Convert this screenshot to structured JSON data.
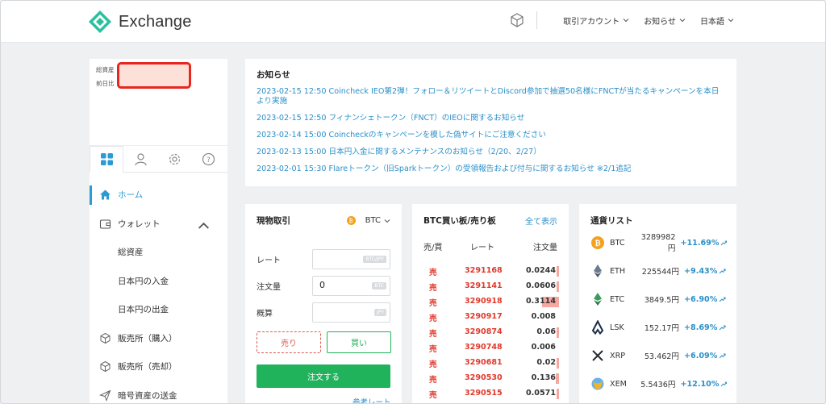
{
  "header": {
    "logo_text": "Exchange",
    "menus": [
      "取引アカウント",
      "お知らせ",
      "日本語"
    ],
    "brand_color": "#2ac09e"
  },
  "sidebar": {
    "assets_label": "総資産",
    "prev_day_label": "前日比",
    "tabs": [
      "dashboard-icon",
      "user-icon",
      "gear-icon",
      "help-icon"
    ],
    "items": [
      {
        "label": "ホーム",
        "icon": "home-icon",
        "active": true
      },
      {
        "label": "ウォレット",
        "icon": "wallet-icon"
      },
      {
        "label": "総資産",
        "sub": true
      },
      {
        "label": "日本円の入金",
        "sub": true
      },
      {
        "label": "日本円の出金",
        "sub": true
      },
      {
        "label": "販売所（購入）",
        "icon": "cube-icon"
      },
      {
        "label": "販売所（売却）",
        "icon": "cube-icon"
      },
      {
        "label": "暗号資産の送金",
        "icon": "send-icon"
      }
    ]
  },
  "notices": {
    "title": "お知らせ",
    "items": [
      "2023-02-15 12:50 Coincheck IEO第2弾！フォロー＆リツイートとDiscord参加で抽選50名様にFNCTが当たるキャンペーンを本日より実施",
      "2023-02-15 12:50 フィナンシェトークン（FNCT）のIEOに関するお知らせ",
      "2023-02-14 15:00 Coincheckのキャンペーンを模した偽サイトにご注意ください",
      "2023-02-13 15:00 日本円入金に関するメンテナンスのお知らせ（2/20、2/27）",
      "2023-02-01 15:30 Flareトークン（旧Sparkトークン）の受領報告および付与に関するお知らせ ※2/1追記"
    ]
  },
  "trade": {
    "title": "現物取引",
    "coin": "BTC",
    "coin_glyph": "₿",
    "rate_label": "レート",
    "rate_tag": "BTC/JPY",
    "qty_label": "注文量",
    "qty_value": "0",
    "qty_tag": "BTC",
    "est_label": "概算",
    "est_tag": "JPY",
    "sell": "売り",
    "buy": "買い",
    "order": "注文する",
    "ref": "参考レート"
  },
  "orderbook": {
    "title": "BTC買い板/売り板",
    "show_all": "全て表示",
    "cols": [
      "売/買",
      "レート",
      "注文量"
    ],
    "rows": [
      {
        "side": "売",
        "rate": "3291168",
        "qty": "0.0244",
        "bar": 0.04
      },
      {
        "side": "売",
        "rate": "3291141",
        "qty": "0.0606",
        "bar": 0.04
      },
      {
        "side": "売",
        "rate": "3290918",
        "qty": "0.3114",
        "bar": 0.35
      },
      {
        "side": "売",
        "rate": "3290917",
        "qty": "0.008",
        "bar": 0.0
      },
      {
        "side": "売",
        "rate": "3290874",
        "qty": "0.06",
        "bar": 0.04
      },
      {
        "side": "売",
        "rate": "3290748",
        "qty": "0.006",
        "bar": 0.0
      },
      {
        "side": "売",
        "rate": "3290681",
        "qty": "0.02",
        "bar": 0.03
      },
      {
        "side": "売",
        "rate": "3290530",
        "qty": "0.136",
        "bar": 0.06
      },
      {
        "side": "売",
        "rate": "3290515",
        "qty": "0.0571",
        "bar": 0.04
      },
      {
        "side": "売",
        "rate": "",
        "qty": "",
        "bar": 0.0
      }
    ]
  },
  "currencies": {
    "title": "通貨リスト",
    "rows": [
      {
        "sym": "BTC",
        "price": "3289982円",
        "chg": "+11.69%",
        "icon": "btc-icon",
        "color": "#f3a11e"
      },
      {
        "sym": "ETH",
        "price": "225544円",
        "chg": "+9.43%",
        "icon": "eth-icon",
        "color": "#6b7a8f"
      },
      {
        "sym": "ETC",
        "price": "3849.5円",
        "chg": "+6.90%",
        "icon": "etc-icon",
        "color": "#3c9a5f"
      },
      {
        "sym": "LSK",
        "price": "152.17円",
        "chg": "+8.69%",
        "icon": "lsk-icon",
        "color": "#1a2b4a"
      },
      {
        "sym": "XRP",
        "price": "53.462円",
        "chg": "+6.09%",
        "icon": "xrp-icon",
        "color": "#23292f"
      },
      {
        "sym": "XEM",
        "price": "5.5436円",
        "chg": "+12.10%",
        "icon": "xem-icon",
        "color": "#67b2e8"
      }
    ]
  }
}
